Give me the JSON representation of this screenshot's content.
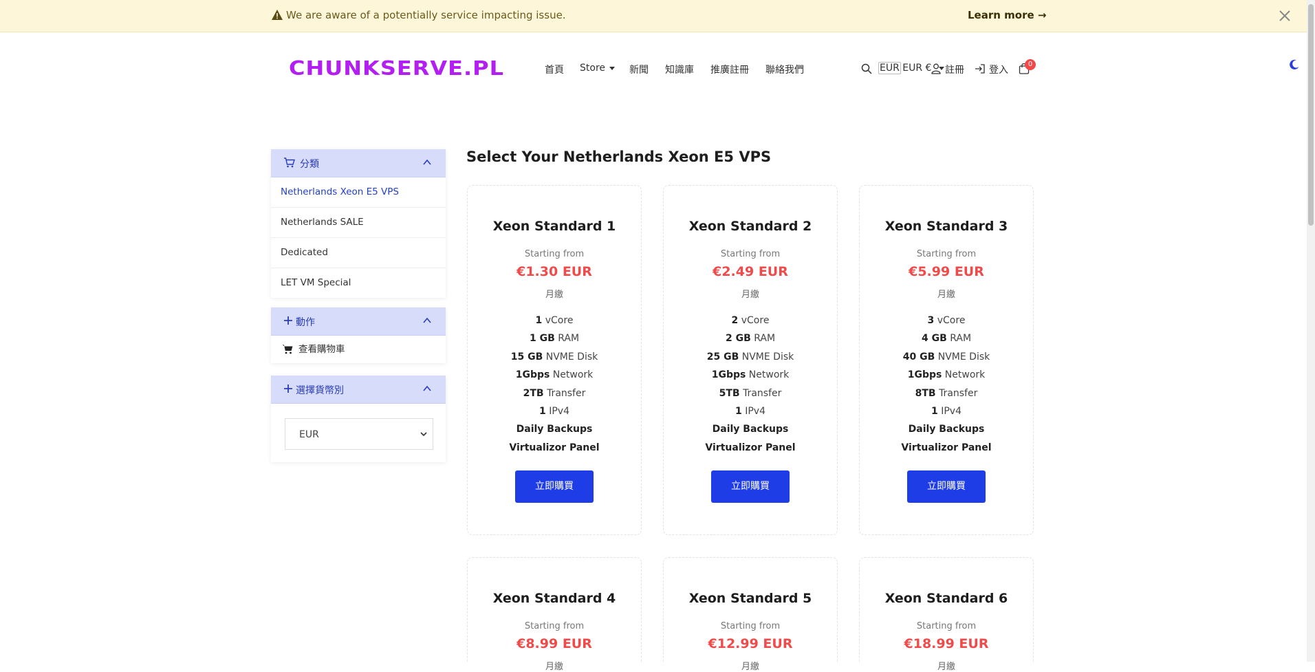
{
  "alert": {
    "message": "We are aware of a potentially service impacting issue.",
    "learn_more": "Learn more →"
  },
  "header": {
    "logo": "CHUNKSERVE.PL",
    "nav": [
      "首頁",
      "Store",
      "新聞",
      "知識庫",
      "推廣註冊",
      "聯絡我們"
    ],
    "currency": "EUR €",
    "currency_flag_alt": "EUR",
    "register": "註冊",
    "login": "登入",
    "cart_count": "0"
  },
  "sidebar": {
    "categories_title": "分類",
    "categories": [
      "Netherlands Xeon E5 VPS",
      "Netherlands SALE",
      "Dedicated",
      "LET VM Special"
    ],
    "actions_title": "動作",
    "actions": [
      "查看購物車"
    ],
    "currency_title": "選擇貨幣別",
    "currency_value": "EUR"
  },
  "main": {
    "title": "Select Your Netherlands Xeon E5 VPS",
    "products": [
      {
        "name": "Xeon Standard 1",
        "starting": "Starting from",
        "price": "€1.30 EUR",
        "cycle": "月繳",
        "features": [
          {
            "v": "1",
            "t": "vCore"
          },
          {
            "v": "1 GB",
            "t": "RAM"
          },
          {
            "v": "15 GB",
            "t": "NVME Disk"
          },
          {
            "v": "1Gbps",
            "t": "Network"
          },
          {
            "v": "2TB",
            "t": "Transfer"
          },
          {
            "v": "1",
            "t": "IPv4"
          },
          {
            "v": "Daily Backups",
            "t": ""
          },
          {
            "v": "Virtualizor Panel",
            "t": ""
          }
        ],
        "button": "立即購買"
      },
      {
        "name": "Xeon Standard 2",
        "starting": "Starting from",
        "price": "€2.49 EUR",
        "cycle": "月繳",
        "features": [
          {
            "v": "2",
            "t": "vCore"
          },
          {
            "v": "2 GB",
            "t": "RAM"
          },
          {
            "v": "25 GB",
            "t": "NVME Disk"
          },
          {
            "v": "1Gbps",
            "t": "Network"
          },
          {
            "v": "5TB",
            "t": "Transfer"
          },
          {
            "v": "1",
            "t": "IPv4"
          },
          {
            "v": "Daily Backups",
            "t": ""
          },
          {
            "v": "Virtualizor Panel",
            "t": ""
          }
        ],
        "button": "立即購買"
      },
      {
        "name": "Xeon Standard 3",
        "starting": "Starting from",
        "price": "€5.99 EUR",
        "cycle": "月繳",
        "features": [
          {
            "v": "3",
            "t": "vCore"
          },
          {
            "v": "4 GB",
            "t": "RAM"
          },
          {
            "v": "40 GB",
            "t": "NVME Disk"
          },
          {
            "v": "1Gbps",
            "t": "Network"
          },
          {
            "v": "8TB",
            "t": "Transfer"
          },
          {
            "v": "1",
            "t": "IPv4"
          },
          {
            "v": "Daily Backups",
            "t": ""
          },
          {
            "v": "Virtualizor Panel",
            "t": ""
          }
        ],
        "button": "立即購買"
      },
      {
        "name": "Xeon Standard 4",
        "starting": "Starting from",
        "price": "€8.99 EUR",
        "cycle": "月繳"
      },
      {
        "name": "Xeon Standard 5",
        "starting": "Starting from",
        "price": "€12.99 EUR",
        "cycle": "月繳"
      },
      {
        "name": "Xeon Standard 6",
        "starting": "Starting from",
        "price": "€18.99 EUR",
        "cycle": "月繳"
      }
    ]
  }
}
